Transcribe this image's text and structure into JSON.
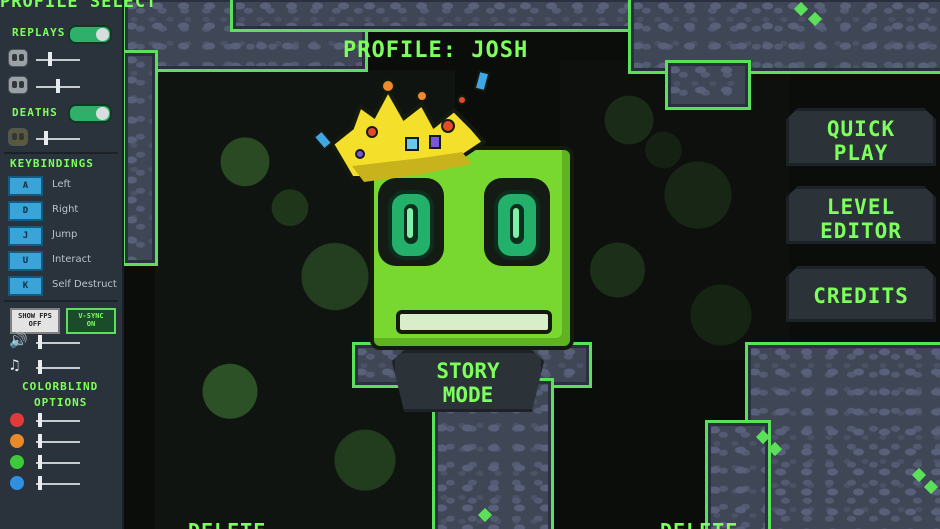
{
  "panel": {
    "title": "PROFILE SELECT",
    "replays_label": "REPLAYS",
    "deaths_label": "DEATHS",
    "keybindings_label": "KEYBINDINGS",
    "keybindings": [
      {
        "key": "A",
        "action": "Left"
      },
      {
        "key": "D",
        "action": "Right"
      },
      {
        "key": "J",
        "action": "Jump"
      },
      {
        "key": "U",
        "action": "Interact"
      },
      {
        "key": "K",
        "action": "Self Destruct"
      }
    ],
    "show_fps": "SHOW FPS OFF",
    "show_fps_line1": "SHOW FPS",
    "show_fps_line2": "OFF",
    "vsync_line1": "V-SYNC",
    "vsync_line2": "ON",
    "colorblind_label_1": "COLORBLIND",
    "colorblind_label_2": "OPTIONS",
    "colorblind_colors": [
      "#e03a3a",
      "#e8892a",
      "#3fc93a",
      "#2f8fe0"
    ]
  },
  "main": {
    "profile_title": "PROFILE: JOSH",
    "story_line1": "STORY",
    "story_line2": "MODE",
    "delete_left": "DELETE",
    "delete_right": "DELETE"
  },
  "menu": {
    "quick_play_1": "QUICK",
    "quick_play_2": "PLAY",
    "level_editor_1": "LEVEL",
    "level_editor_2": "EDITOR",
    "credits": "CREDITS"
  },
  "colors": {
    "accent": "#7dff5c",
    "character": "#79d830",
    "crown": "#f4e02a"
  }
}
